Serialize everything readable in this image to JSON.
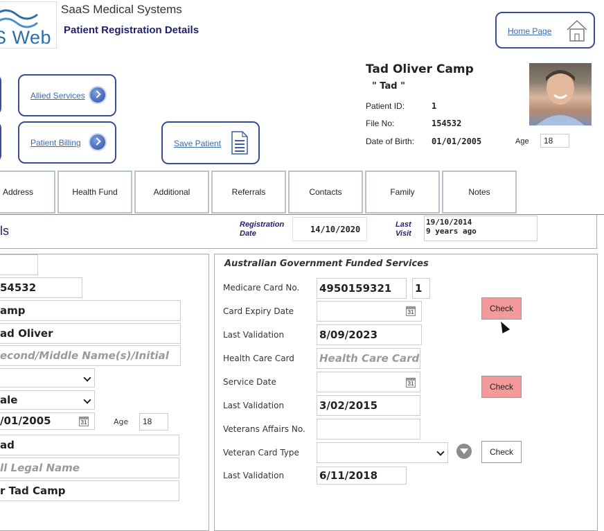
{
  "header": {
    "logo_text": "S Web",
    "app_title": "SaaS Medical Systems",
    "page_title": "Patient Registration Details",
    "home_link": "Home Page"
  },
  "nav_buttons": {
    "allied": "Allied Services",
    "billing": "Patient Billing",
    "save": "Save Patient"
  },
  "patient": {
    "name": "Tad Oliver Camp",
    "nickname": "\" Tad \"",
    "id_label": "Patient ID:",
    "id_value": "1",
    "file_label": "File No:",
    "file_value": "154532",
    "dob_label": "Date of Birth:",
    "dob_value": "01/01/2005",
    "age_label": "Age",
    "age_value": "18"
  },
  "tabs": [
    "Address",
    "Health Fund",
    "Additional",
    "Referrals",
    "Contacts",
    "Family",
    "Notes"
  ],
  "banner": {
    "title_fragment": "ls",
    "reg_date_label": "Registration Date",
    "reg_date_value": "14/10/2020",
    "last_visit_label": "Last Visit",
    "last_visit_line1": "19/10/2014",
    "last_visit_line2": "9 years ago"
  },
  "left_form": {
    "file_no": "54532",
    "surname": "amp",
    "given": "ad Oliver",
    "middle_placeholder": "econd/Middle Name(s)/Initial",
    "gender": "ale",
    "dob": "/01/2005",
    "age_label": "Age",
    "age_value": "18",
    "preferred": "ad",
    "legal_placeholder": "ll Legal Name",
    "full_name": "r Tad Camp"
  },
  "right_form": {
    "section_title": "Australian Government Funded Services",
    "medicare_label": "Medicare Card No.",
    "medicare_value": "4950159321",
    "medicare_irn": "1",
    "card_expiry_label": "Card Expiry Date",
    "card_expiry_value": "",
    "last_validation_label": "Last Validation",
    "last_validation_1": "8/09/2023",
    "health_care_label": "Health Care Card",
    "health_care_placeholder": "Health Care Card",
    "service_date_label": "Service Date",
    "service_date_value": "",
    "last_validation_2": "3/02/2015",
    "veterans_label": "Veterans Affairs No.",
    "veterans_value": "",
    "veteran_type_label": "Veteran Card Type",
    "veteran_type_value": "",
    "last_validation_3": "6/11/2018",
    "check_label": "Check"
  },
  "colors": {
    "accent": "#3b4a9a",
    "check_pink": "#f49a9a",
    "title_navy": "#1f1f6e"
  }
}
